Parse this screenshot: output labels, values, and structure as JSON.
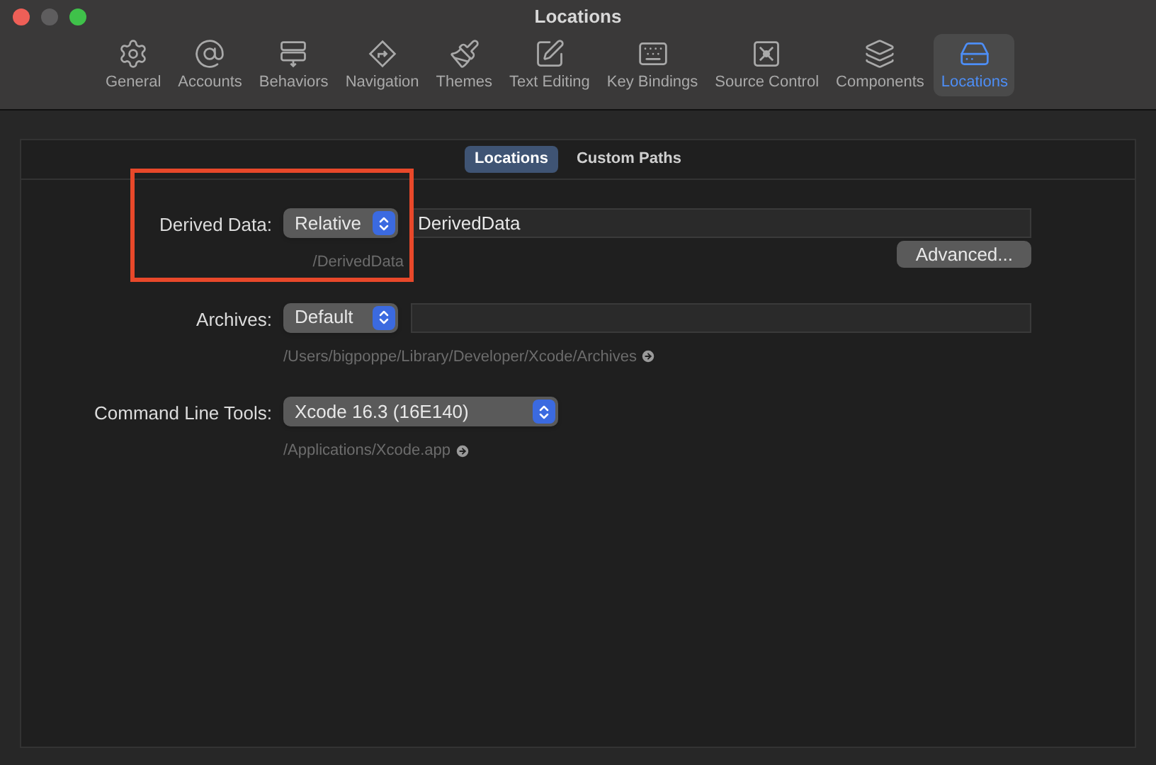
{
  "window": {
    "title": "Locations"
  },
  "toolbar": [
    {
      "kind": "gear",
      "label": "General",
      "selected": false
    },
    {
      "kind": "at",
      "label": "Accounts",
      "selected": false
    },
    {
      "kind": "behaviors",
      "label": "Behaviors",
      "selected": false
    },
    {
      "kind": "navigation",
      "label": "Navigation",
      "selected": false
    },
    {
      "kind": "brush",
      "label": "Themes",
      "selected": false
    },
    {
      "kind": "edit",
      "label": "Text Editing",
      "selected": false
    },
    {
      "kind": "keyboard",
      "label": "Key Bindings",
      "selected": false
    },
    {
      "kind": "source",
      "label": "Source Control",
      "selected": false
    },
    {
      "kind": "layers",
      "label": "Components",
      "selected": false
    },
    {
      "kind": "drive",
      "label": "Locations",
      "selected": true
    }
  ],
  "tabs": [
    {
      "label": "Locations",
      "selected": true
    },
    {
      "label": "Custom Paths",
      "selected": false
    }
  ],
  "rows": [
    {
      "kind": "relative",
      "label": "Derived Data:",
      "popup": "Relative",
      "field": "DerivedData",
      "path": "/DerivedData",
      "highlighted": true,
      "button": "Advanced..."
    },
    {
      "kind": "default",
      "label": "Archives:",
      "popup": "Default",
      "field": "",
      "path": "/Users/bigpoppe/Library/Developer/Xcode/Archives",
      "highlighted": false
    },
    {
      "kind": "tool",
      "label": "Command Line Tools:",
      "popup": "Xcode 16.3 (16E140)",
      "path": "/Applications/Xcode.app",
      "highlighted": false
    }
  ]
}
